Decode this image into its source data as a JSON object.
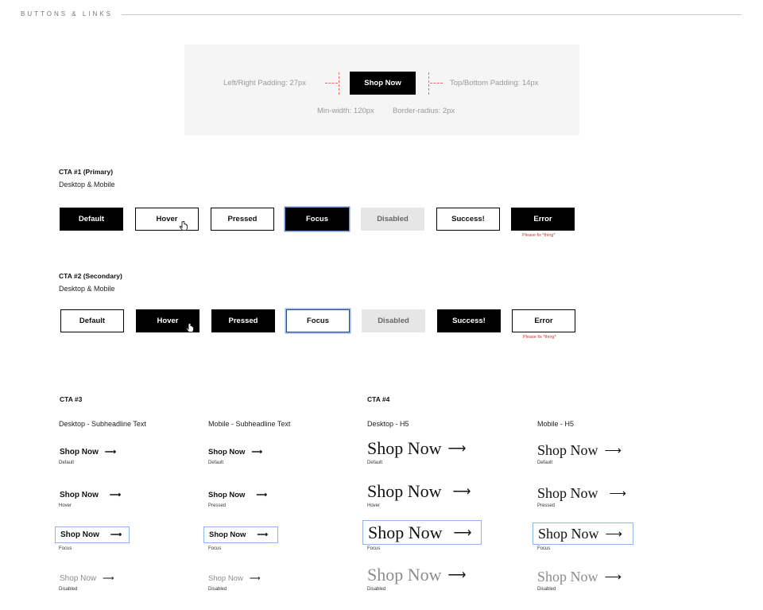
{
  "section": {
    "title": "BUTTONS & LINKS"
  },
  "spec": {
    "left_right_padding": "Left/Right Padding: 27px",
    "top_bottom_padding": "Top/Bottom Padding: 14px",
    "button_label": "Shop Now",
    "min_width": "Min-width: 120px",
    "border_radius": "Border-radius: 2px"
  },
  "cta1": {
    "title": "CTA #1 (Primary)",
    "subtitle": "Desktop & Mobile",
    "buttons": [
      "Default",
      "Hover",
      "Pressed",
      "Focus",
      "Disabled",
      "Success!",
      "Error"
    ],
    "error_note": "Please fix *thing*"
  },
  "cta2": {
    "title": "CTA #2 (Secondary)",
    "subtitle": "Desktop & Mobile",
    "buttons": [
      "Default",
      "Hover",
      "Pressed",
      "Focus",
      "Disabled",
      "Success!",
      "Error"
    ],
    "error_note": "Please fix *thing*"
  },
  "cta3": {
    "title": "CTA #3",
    "columns": [
      {
        "heading": "Desktop - Subheadline Text",
        "states": [
          "Default",
          "Hover",
          "Focus",
          "Disabled"
        ]
      },
      {
        "heading": "Mobile - Subheadline Text",
        "states": [
          "Default",
          "Pressed",
          "Focus",
          "Disabled"
        ]
      }
    ]
  },
  "cta4": {
    "title": "CTA #4",
    "columns": [
      {
        "heading": "Desktop - H5",
        "states": [
          "Default",
          "Hover",
          "Focus",
          "Disabled"
        ]
      },
      {
        "heading": "Mobile - H5",
        "states": [
          "Default",
          "Pressed",
          "Focus",
          "Disabled"
        ]
      }
    ]
  },
  "link_label": "Shop Now",
  "arrow": "⟶",
  "colors": {
    "primary": "#000000",
    "disabled_bg": "#e6e6e6",
    "focus_ring": "#8fb6ec",
    "error_text": "#c0392b",
    "spec_guide": "#e8686a"
  },
  "icons": [
    "hand-pointer-cursor-icon"
  ]
}
